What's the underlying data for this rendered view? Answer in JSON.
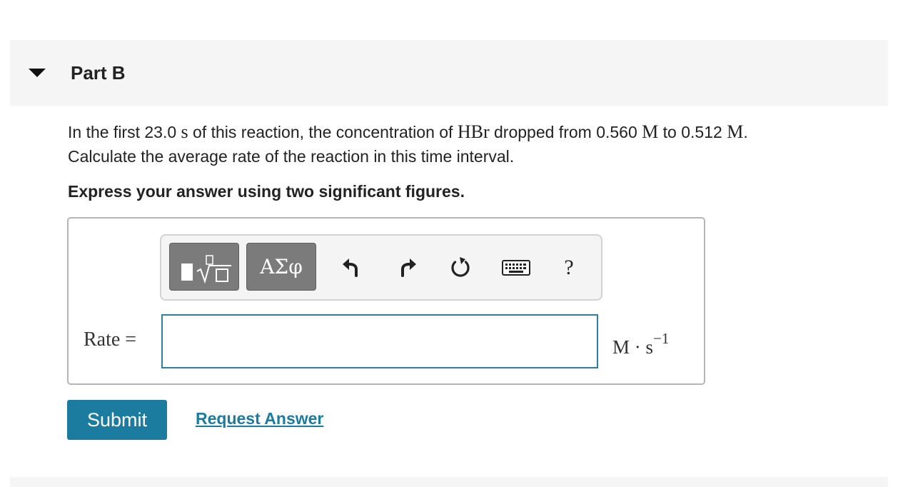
{
  "part": {
    "title": "Part B"
  },
  "question": {
    "t1": "In the first 23.0 ",
    "m1": "s",
    "t2": " of this reaction, the concentration of ",
    "m2": "HBr",
    "t3": " dropped from 0.560 ",
    "m3": "M",
    "t4": " to 0.512 ",
    "m4": "M",
    "t5": ".",
    "line2": "Calculate the average rate of the reaction in this time interval."
  },
  "instruction": "Express your answer using two significant figures.",
  "toolbar": {
    "greek_label": "ΑΣφ",
    "help_label": "?"
  },
  "answer": {
    "label": "Rate =",
    "value": "",
    "units_base": "M · s",
    "units_exp": "−1"
  },
  "actions": {
    "submit_label": "Submit",
    "request_label": "Request Answer"
  },
  "colors": {
    "accent": "#1c7ca0",
    "input_border": "#2e7fa5",
    "toolbar_dark": "#7b7b7b"
  }
}
